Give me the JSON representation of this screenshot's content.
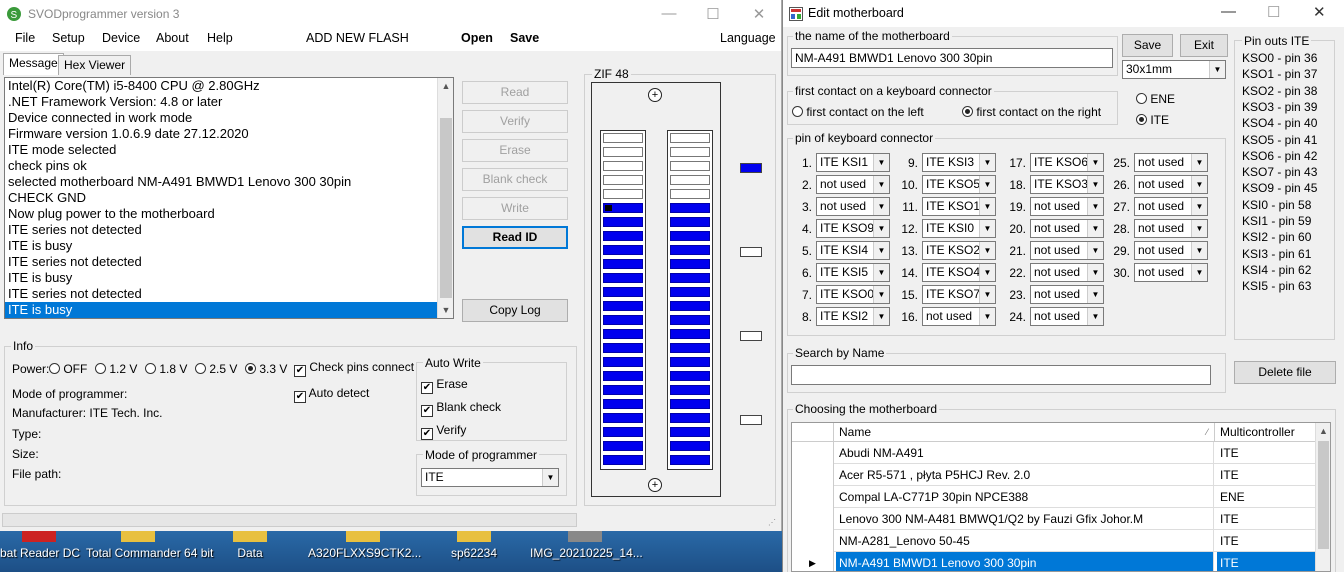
{
  "main_window": {
    "title": "SVODprogrammer version 3",
    "menu": [
      "File",
      "Setup",
      "Device",
      "About",
      "Help"
    ],
    "menu_add_flash": "ADD NEW FLASH",
    "menu_open": "Open",
    "menu_save": "Save",
    "menu_language": "Language",
    "tabs": [
      "Message",
      "Hex Viewer"
    ],
    "log": [
      "Intel(R) Core(TM) i5-8400 CPU @ 2.80GHz",
      ".NET Framework Version: 4.8 or later",
      "Device connected in work mode",
      "Firmware version 1.0.6.9 date 27.12.2020",
      "ITE mode selected",
      "check pins ok",
      "selected motherboard NM-A491 BMWD1 Lenovo 300  30pin",
      "CHECK GND",
      "Now plug power to the motherboard",
      "ITE series not detected",
      "ITE is busy",
      "ITE series not detected",
      "ITE is busy",
      "ITE series not detected",
      "ITE is busy"
    ],
    "buttons": {
      "read": "Read",
      "verify": "Verify",
      "erase": "Erase",
      "blank_check": "Blank check",
      "write": "Write",
      "read_id": "Read ID",
      "copy_log": "Copy Log"
    },
    "zif_label": "ZIF 48",
    "info": {
      "group_label": "Info",
      "power_label": "Power:",
      "power_options": [
        "OFF",
        "1.2 V",
        "1.8 V",
        "2.5 V",
        "3.3 V"
      ],
      "power_selected": "3.3 V",
      "check_pins_connect": "Check pins connect",
      "auto_detect": "Auto detect",
      "mode_of_programmer": "Mode of programmer:",
      "manufacturer": "Manufacturer: ITE Tech. Inc.",
      "type": "Type:",
      "size": "Size:",
      "file_path": "File path:"
    },
    "auto_write": {
      "label": "Auto Write",
      "erase": "Erase",
      "blank_check": "Blank check",
      "verify": "Verify"
    },
    "mode_group": {
      "label": "Mode of programmer",
      "value": "ITE"
    }
  },
  "desktop_icons": [
    "bat Reader DC",
    "Total Commander 64 bit",
    "Data",
    "A320FLXXS9CTK2...",
    "sp62234",
    "IMG_20210225_14..."
  ],
  "edit_window": {
    "title": "Edit motherboard",
    "name_group_label": "the name of the motherboard",
    "name_value": "NM-A491 BMWD1 Lenovo 300  30pin",
    "save": "Save",
    "exit": "Exit",
    "size_combo": "30x1mm",
    "first_contact_label": "first contact on a keyboard connector",
    "first_contact_left": "first contact on the left",
    "first_contact_right": "first contact on the right",
    "ene": "ENE",
    "ite": "ITE",
    "pins_group_label": "pin of keyboard connector",
    "pins": [
      "ITE KSI1",
      "not used",
      "not used",
      "ITE KSO9",
      "ITE KSI4",
      "ITE KSI5",
      "ITE KSO0",
      "ITE KSI2",
      "ITE KSI3",
      "ITE KSO5",
      "ITE KSO1",
      "ITE KSI0",
      "ITE KSO2",
      "ITE KSO4",
      "ITE KSO7",
      "not used",
      "ITE KSO6",
      "ITE KSO3",
      "not used",
      "not used",
      "not used",
      "not used",
      "not used",
      "not used",
      "not used",
      "not used",
      "not used",
      "not used",
      "not used",
      "not used"
    ],
    "pin_outs_label": "Pin outs ITE",
    "pin_outs": [
      "KSO0 - pin 36",
      "KSO1 - pin 37",
      "KSO2 - pin 38",
      "KSO3 - pin 39",
      "KSO4 - pin 40",
      "KSO5 - pin 41",
      "KSO6 - pin 42",
      "KSO7 - pin 43",
      "KSO9 - pin 45",
      "KSI0 - pin 58",
      "KSI1 - pin 59",
      "KSI2 - pin 60",
      "KSI3 - pin 61",
      "KSI4 - pin 62",
      "KSI5 - pin 63"
    ],
    "search_label": "Search by Name",
    "search_value": "",
    "delete_file": "Delete file",
    "choose_label": "Choosing the motherboard",
    "grid_headers": [
      "Name",
      "Multicontroller"
    ],
    "grid_rows": [
      {
        "name": "Abudi NM-A491",
        "mc": "ITE"
      },
      {
        "name": "Acer R5-571 , płyta P5HCJ Rev. 2.0",
        "mc": "ITE"
      },
      {
        "name": "Compal LA-C771P 30pin  NPCE388",
        "mc": "ENE"
      },
      {
        "name": "Lenovo 300 NM-A481 BMWQ1/Q2 by Fauzi Gfix Johor.M",
        "mc": "ITE"
      },
      {
        "name": "NM-A281_Lenovo 50-45",
        "mc": "ITE"
      },
      {
        "name": "NM-A491 BMWD1 Lenovo 300  30pin",
        "mc": "ITE"
      }
    ]
  },
  "colors": {
    "accent": "#0078d7",
    "pin_on": "#0000ee"
  }
}
